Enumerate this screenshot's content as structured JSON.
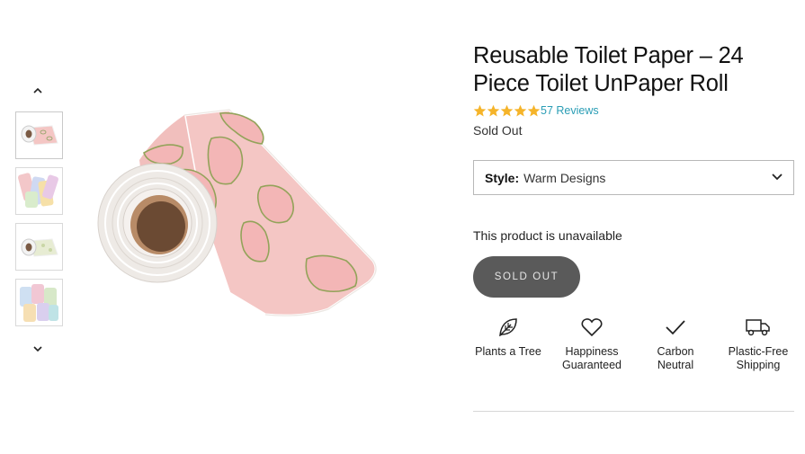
{
  "gallery": {
    "up_arrow_icon": "chevron-up-icon",
    "down_arrow_icon": "chevron-down-icon",
    "thumbnails": [
      {
        "name": "pink-roll-thumb"
      },
      {
        "name": "assorted-sheets-thumb"
      },
      {
        "name": "green-roll-thumb"
      },
      {
        "name": "pattern-sheets-thumb"
      }
    ]
  },
  "product": {
    "title": "Reusable Toilet Paper – 24 Piece Toilet UnPaper Roll",
    "rating": 5,
    "reviews_label": "57 Reviews",
    "status": "Sold Out",
    "style_label": "Style:",
    "style_value": "Warm Designs",
    "unavailable_text": "This product is unavailable",
    "button_label": "SOLD OUT"
  },
  "features": [
    {
      "icon": "leaf-icon",
      "line1": "Plants a Tree",
      "line2": ""
    },
    {
      "icon": "heart-icon",
      "line1": "Happiness",
      "line2": "Guaranteed"
    },
    {
      "icon": "checkmark-icon",
      "line1": "Carbon",
      "line2": "Neutral"
    },
    {
      "icon": "truck-icon",
      "line1": "Plastic-Free",
      "line2": "Shipping"
    }
  ],
  "colors": {
    "star": "#f5b42a",
    "link": "#2a9db5",
    "button_bg": "#5a5a5a",
    "roll_pink": "#f4c6c4"
  }
}
